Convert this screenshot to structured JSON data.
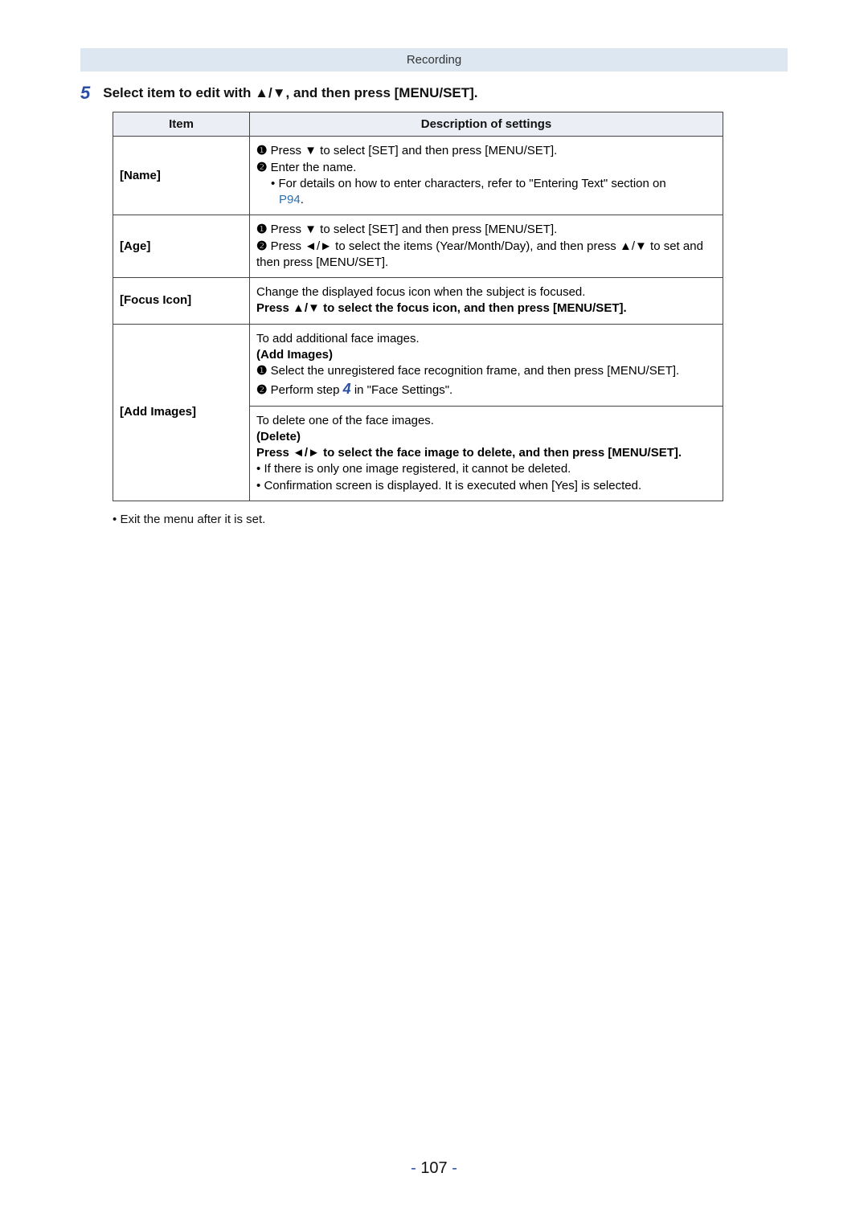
{
  "header": {
    "section": "Recording"
  },
  "step": {
    "number": "5",
    "text_prefix": "Select item to edit with ",
    "arrows": "▲/▼",
    "text_suffix": ", and then press [MENU/SET]."
  },
  "table": {
    "head_item": "Item",
    "head_desc": "Description of settings",
    "rows": {
      "name": {
        "label": "[Name]",
        "l1_prefix": "Press ",
        "l1_arrow": "▼",
        "l1_suffix": " to select [SET] and then press [MENU/SET].",
        "l2": "Enter the name.",
        "l3_prefix": "For details on how to enter characters, refer to \"Entering Text\" section on ",
        "l3_link": "P94",
        "l3_suffix": "."
      },
      "age": {
        "label": "[Age]",
        "l1_prefix": "Press ",
        "l1_arrow": "▼",
        "l1_suffix": " to select [SET] and then press [MENU/SET].",
        "l2_prefix": "Press ",
        "l2_arrows": "◄/►",
        "l2_mid": " to select the items (Year/Month/Day), and then press ",
        "l2_arrows2": "▲/▼",
        "l2_suffix": " to set and then press [MENU/SET]."
      },
      "focus": {
        "label": "[Focus Icon]",
        "l1": "Change the displayed focus icon when the subject is focused.",
        "l2_prefix": "Press ",
        "l2_arrows": "▲/▼",
        "l2_suffix": " to select the focus icon, and then press [MENU/SET]."
      },
      "addimg": {
        "label": "[Add Images]",
        "add_l1": "To add additional face images.",
        "add_head": "(Add Images)",
        "add_l2": "Select the unregistered face recognition frame, and then press [MENU/SET].",
        "add_l3_prefix": "Perform step ",
        "add_l3_step": "4",
        "add_l3_suffix": " in \"Face Settings\".",
        "del_l1": "To delete one of the face images.",
        "del_head": "(Delete)",
        "del_l2_prefix": "Press ",
        "del_l2_arrows": "◄/►",
        "del_l2_suffix": " to select the face image to delete, and then press [MENU/SET].",
        "del_l3": "If there is only one image registered, it cannot be deleted.",
        "del_l4": "Confirmation screen is displayed. It is executed when [Yes] is selected."
      }
    }
  },
  "footer_note": "Exit the menu after it is set.",
  "page_number": "107",
  "icons": {
    "circ1": "❶",
    "circ2": "❷",
    "bullet": "•"
  }
}
